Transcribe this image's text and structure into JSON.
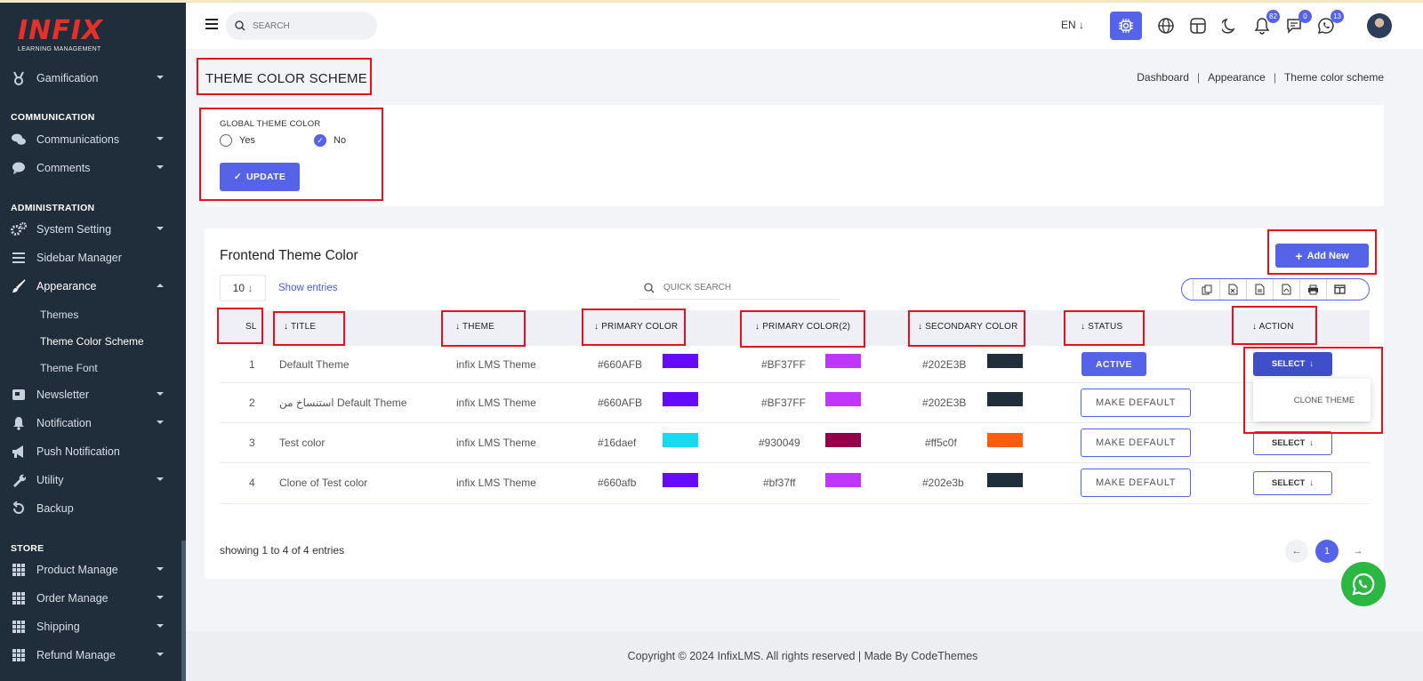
{
  "app": {
    "logo_text": "INFIX",
    "logo_sub": "LEARNING MANAGEMENT"
  },
  "sidebar": {
    "items": [
      {
        "label": "Gamification",
        "icon": "medal-icon"
      },
      {
        "label": "Communications",
        "icon": "chat-icon"
      },
      {
        "label": "Comments",
        "icon": "comment-icon"
      },
      {
        "label": "System Setting",
        "icon": "gears-icon"
      },
      {
        "label": "Sidebar Manager",
        "icon": "menu-icon"
      },
      {
        "label": "Appearance",
        "icon": "brush-icon"
      },
      {
        "label": "Newsletter",
        "icon": "newsletter-icon"
      },
      {
        "label": "Notification",
        "icon": "bell-icon"
      },
      {
        "label": "Push Notification",
        "icon": "megaphone-icon"
      },
      {
        "label": "Utility",
        "icon": "wrench-icon"
      },
      {
        "label": "Backup",
        "icon": "backup-icon"
      },
      {
        "label": "Product Manage",
        "icon": "grid-icon"
      },
      {
        "label": "Order Manage",
        "icon": "grid-icon"
      },
      {
        "label": "Shipping",
        "icon": "grid-icon"
      },
      {
        "label": "Refund Manage",
        "icon": "grid-icon"
      }
    ],
    "headings": {
      "communication": "COMMUNICATION",
      "administration": "ADMINISTRATION",
      "store": "STORE"
    },
    "appearance_sub": [
      "Themes",
      "Theme Color Scheme",
      "Theme Font"
    ]
  },
  "header": {
    "search_placeholder": "SEARCH",
    "lang": "EN",
    "badges": {
      "notifications": "82",
      "messages": "0",
      "whatsapp": "13"
    }
  },
  "page": {
    "title": "THEME COLOR SCHEME",
    "breadcrumb": [
      "Dashboard",
      "Appearance",
      "Theme color scheme"
    ],
    "breadcrumb_sep": "|"
  },
  "global": {
    "label": "GLOBAL THEME COLOR",
    "yes": "Yes",
    "no": "No",
    "selected": "No",
    "update": "UPDATE"
  },
  "frontend": {
    "title": "Frontend Theme Color",
    "add_new": "Add New",
    "per_page": "10",
    "show_entries": "Show entries",
    "quick_search": "QUICK SEARCH",
    "columns": [
      "SL",
      "TITLE",
      "THEME",
      "PRIMARY COLOR",
      "PRIMARY COLOR(2)",
      "SECONDARY COLOR",
      "STATUS",
      "ACTION"
    ],
    "rows": [
      {
        "sl": "1",
        "title": "Default Theme",
        "theme": "infix LMS Theme",
        "primary": "#660AFB",
        "primary2": "#BF37FF",
        "secondary": "#202E3B",
        "status": "ACTIVE",
        "action": "SELECT"
      },
      {
        "sl": "2",
        "title": "استنساخ من Default Theme",
        "theme": "infix LMS Theme",
        "primary": "#660AFB",
        "primary2": "#BF37FF",
        "secondary": "#202E3B",
        "status": "MAKE DEFAULT",
        "action": "SELECT"
      },
      {
        "sl": "3",
        "title": "Test color",
        "theme": "infix LMS Theme",
        "primary": "#16daef",
        "primary2": "#930049",
        "secondary": "#ff5c0f",
        "status": "MAKE DEFAULT",
        "action": "SELECT"
      },
      {
        "sl": "4",
        "title": "Clone of Test color",
        "theme": "infix LMS Theme",
        "primary": "#660afb",
        "primary2": "#bf37ff",
        "secondary": "#202e3b",
        "status": "MAKE DEFAULT",
        "action": "SELECT"
      }
    ],
    "dropdown_item": "CLONE THEME",
    "showing": "showing 1 to 4 of 4 entries",
    "current_page": "1"
  },
  "footer": {
    "text": "Copyright © 2024 InfixLMS. All rights reserved | Made By CodeThemes"
  },
  "colors": {
    "accent": "#5463e8",
    "sidebar_bg": "#202e3b",
    "highlight": "#e8101a"
  }
}
